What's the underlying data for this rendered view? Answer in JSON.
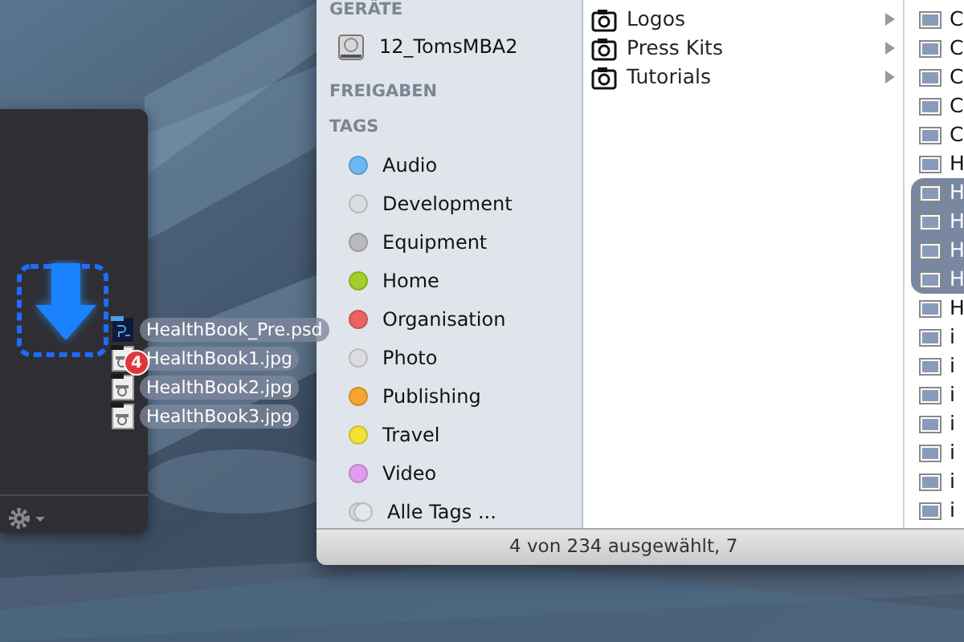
{
  "drag": {
    "count": "4",
    "files": [
      {
        "name": "HealthBook_Pre.psd",
        "kind": "psd"
      },
      {
        "name": "HealthBook1.jpg",
        "kind": "jpg"
      },
      {
        "name": "HealthBook2.jpg",
        "kind": "jpg"
      },
      {
        "name": "HealthBook3.jpg",
        "kind": "jpg"
      }
    ]
  },
  "finder": {
    "sidebar": {
      "sections": [
        {
          "title": "GERÄTE",
          "items": [
            {
              "label": "12_TomsMBA2",
              "kind": "disk"
            }
          ]
        },
        {
          "title": "FREIGABEN"
        },
        {
          "title": "TAGS",
          "items": [
            {
              "label": "Audio",
              "kind": "tag",
              "color": "#6cb8f3"
            },
            {
              "label": "Development",
              "kind": "tag",
              "color": "#dcdde0"
            },
            {
              "label": "Equipment",
              "kind": "tag",
              "color": "#bababc"
            },
            {
              "label": "Home",
              "kind": "tag",
              "color": "#a3cf2a"
            },
            {
              "label": "Organisation",
              "kind": "tag",
              "color": "#ea6465"
            },
            {
              "label": "Photo",
              "kind": "tag",
              "color": "#dcdde0"
            },
            {
              "label": "Publishing",
              "kind": "tag",
              "color": "#f7a52f"
            },
            {
              "label": "Travel",
              "kind": "tag",
              "color": "#f3e234"
            },
            {
              "label": "Video",
              "kind": "tag",
              "color": "#e49cf1"
            },
            {
              "label": "Alle Tags ...",
              "kind": "all"
            }
          ]
        }
      ]
    },
    "folders": [
      {
        "label": "Logos"
      },
      {
        "label": "Press Kits"
      },
      {
        "label": "Tutorials"
      }
    ],
    "files": [
      {
        "label": "C",
        "selected": false
      },
      {
        "label": "C",
        "selected": false
      },
      {
        "label": "C",
        "selected": false
      },
      {
        "label": "C",
        "selected": false
      },
      {
        "label": "C",
        "selected": false
      },
      {
        "label": "H",
        "selected": false
      },
      {
        "label": "H",
        "selected": true
      },
      {
        "label": "H",
        "selected": true
      },
      {
        "label": "H",
        "selected": true
      },
      {
        "label": "H",
        "selected": true
      },
      {
        "label": "H",
        "selected": false
      },
      {
        "label": "i",
        "selected": false
      },
      {
        "label": "i",
        "selected": false
      },
      {
        "label": "i",
        "selected": false
      },
      {
        "label": "i",
        "selected": false
      },
      {
        "label": "i",
        "selected": false
      },
      {
        "label": "i",
        "selected": false
      },
      {
        "label": "i",
        "selected": false
      }
    ],
    "status_bar": "4 von 234 ausgewählt, 7"
  }
}
